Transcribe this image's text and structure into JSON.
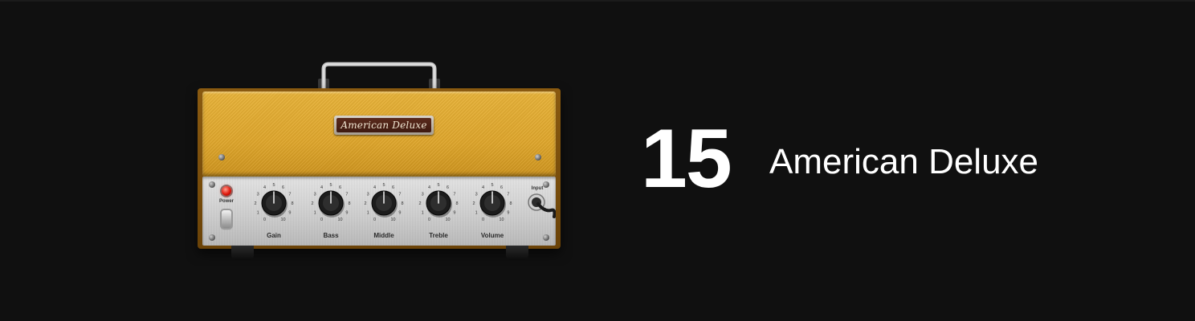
{
  "preset": {
    "number": "15",
    "name": "American Deluxe"
  },
  "amp": {
    "nameplate": "American Deluxe",
    "power_label": "Power",
    "input_label": "Input",
    "colors": {
      "tolex": "#e3aa30",
      "panel": "#d2d2d2",
      "led": "#e0180c",
      "background": "#101010"
    },
    "knobs": [
      {
        "label": "Gain",
        "value": 5
      },
      {
        "label": "Bass",
        "value": 5
      },
      {
        "label": "Middle",
        "value": 5
      },
      {
        "label": "Treble",
        "value": 5
      },
      {
        "label": "Volume",
        "value": 5
      }
    ],
    "scale": [
      "0",
      "1",
      "2",
      "3",
      "4",
      "5",
      "6",
      "7",
      "8",
      "9",
      "10"
    ]
  }
}
